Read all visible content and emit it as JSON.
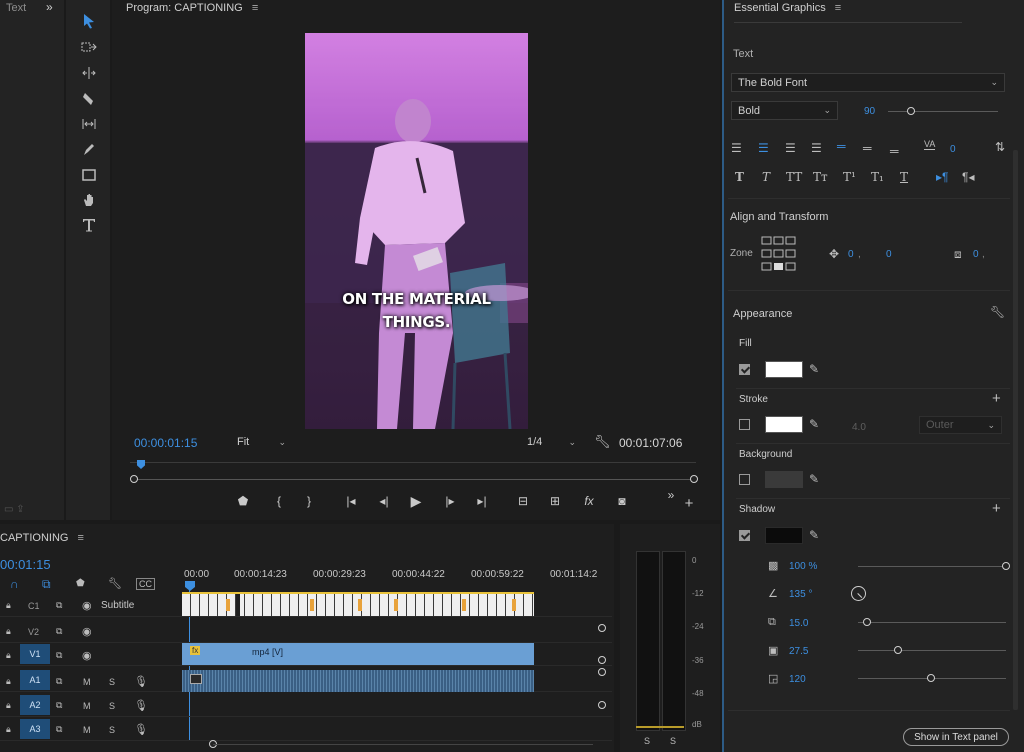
{
  "left_panel": {
    "title": "Text",
    "expand_icon": "double-chevron-right"
  },
  "program": {
    "title": "Program: CAPTIONING",
    "caption_line1": "ON THE MATERIAL",
    "caption_line2": "THINGS.",
    "current_time": "00:00:01:15",
    "fit": "Fit",
    "resolution": "1/4",
    "duration": "00:01:07:06"
  },
  "timeline": {
    "title": "CAPTIONING",
    "timecode": "00:01:15",
    "ruler": [
      "00:00",
      "00:00:14:23",
      "00:00:29:23",
      "00:00:44:22",
      "00:00:59:22",
      "00:01:14:2"
    ],
    "tracks": [
      {
        "name": "C1",
        "label": "Subtitle"
      },
      {
        "name": "V2",
        "label": ""
      },
      {
        "name": "V1",
        "label": ""
      },
      {
        "name": "A1",
        "label": ""
      },
      {
        "name": "A2",
        "label": ""
      },
      {
        "name": "A3",
        "label": ""
      }
    ],
    "v1_clip": "mp4 [V]",
    "m": "M",
    "s": "S"
  },
  "meters": {
    "scale": [
      "0",
      "-12",
      "-24",
      "-36",
      "-48",
      "dB"
    ],
    "solo": [
      "S",
      "S"
    ]
  },
  "eg": {
    "title": "Essential Graphics",
    "text_section": "Text",
    "font": "The Bold Font",
    "style": "Bold",
    "size": "90",
    "tracking": "0",
    "align_section": "Align and Transform",
    "zone": "Zone",
    "pos_x": "0",
    "pos_y": "0",
    "anchor": "0",
    "appearance": "Appearance",
    "fill": "Fill",
    "stroke": "Stroke",
    "stroke_width": "4.0",
    "stroke_type": "Outer",
    "background": "Background",
    "shadow": "Shadow",
    "opacity": "100 %",
    "angle": "135 °",
    "distance": "15.0",
    "blur": "27.5",
    "spread": "120",
    "show_panel": "Show in Text panel"
  },
  "colors": {
    "accent": "#3d8fe0",
    "clip_video": "#6a9fd4",
    "caption_yellow": "#e8c23a"
  }
}
